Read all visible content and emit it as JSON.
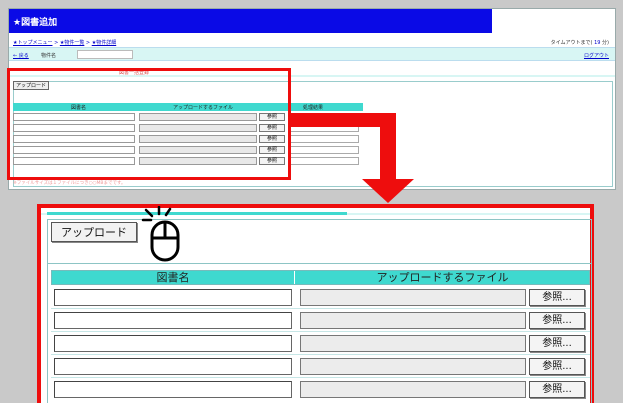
{
  "window": {
    "title": "★図書追加",
    "breadcrumbs": [
      "★トップメニュー",
      "★物件一覧",
      "★物件詳細"
    ],
    "timeout_label": "タイムアウトまで",
    "timeout_value": "19",
    "timeout_unit": "分",
    "back_link": "← 戻る",
    "object_name_label": "物件名",
    "logout_link": "ログアウト",
    "tab2_label": "図書一括登録",
    "note": "※ファイルサイズは１ファイルにつき○○MBまでです。"
  },
  "small_form": {
    "upload_button": "アップロード",
    "columns": [
      "図書名",
      "アップロードするファイル",
      "処理結果"
    ],
    "browse_label": "参照"
  },
  "zoom_form": {
    "upload_button": "アップロード",
    "columns": [
      "図書名",
      "アップロードするファイル"
    ],
    "browse_label": "参照..."
  },
  "colors": {
    "highlight": "#ee0d0d",
    "titlebar": "#0a0ae6",
    "table_header": "#3fd9cf"
  },
  "icons": {
    "pointer": "mouse-click-icon"
  }
}
